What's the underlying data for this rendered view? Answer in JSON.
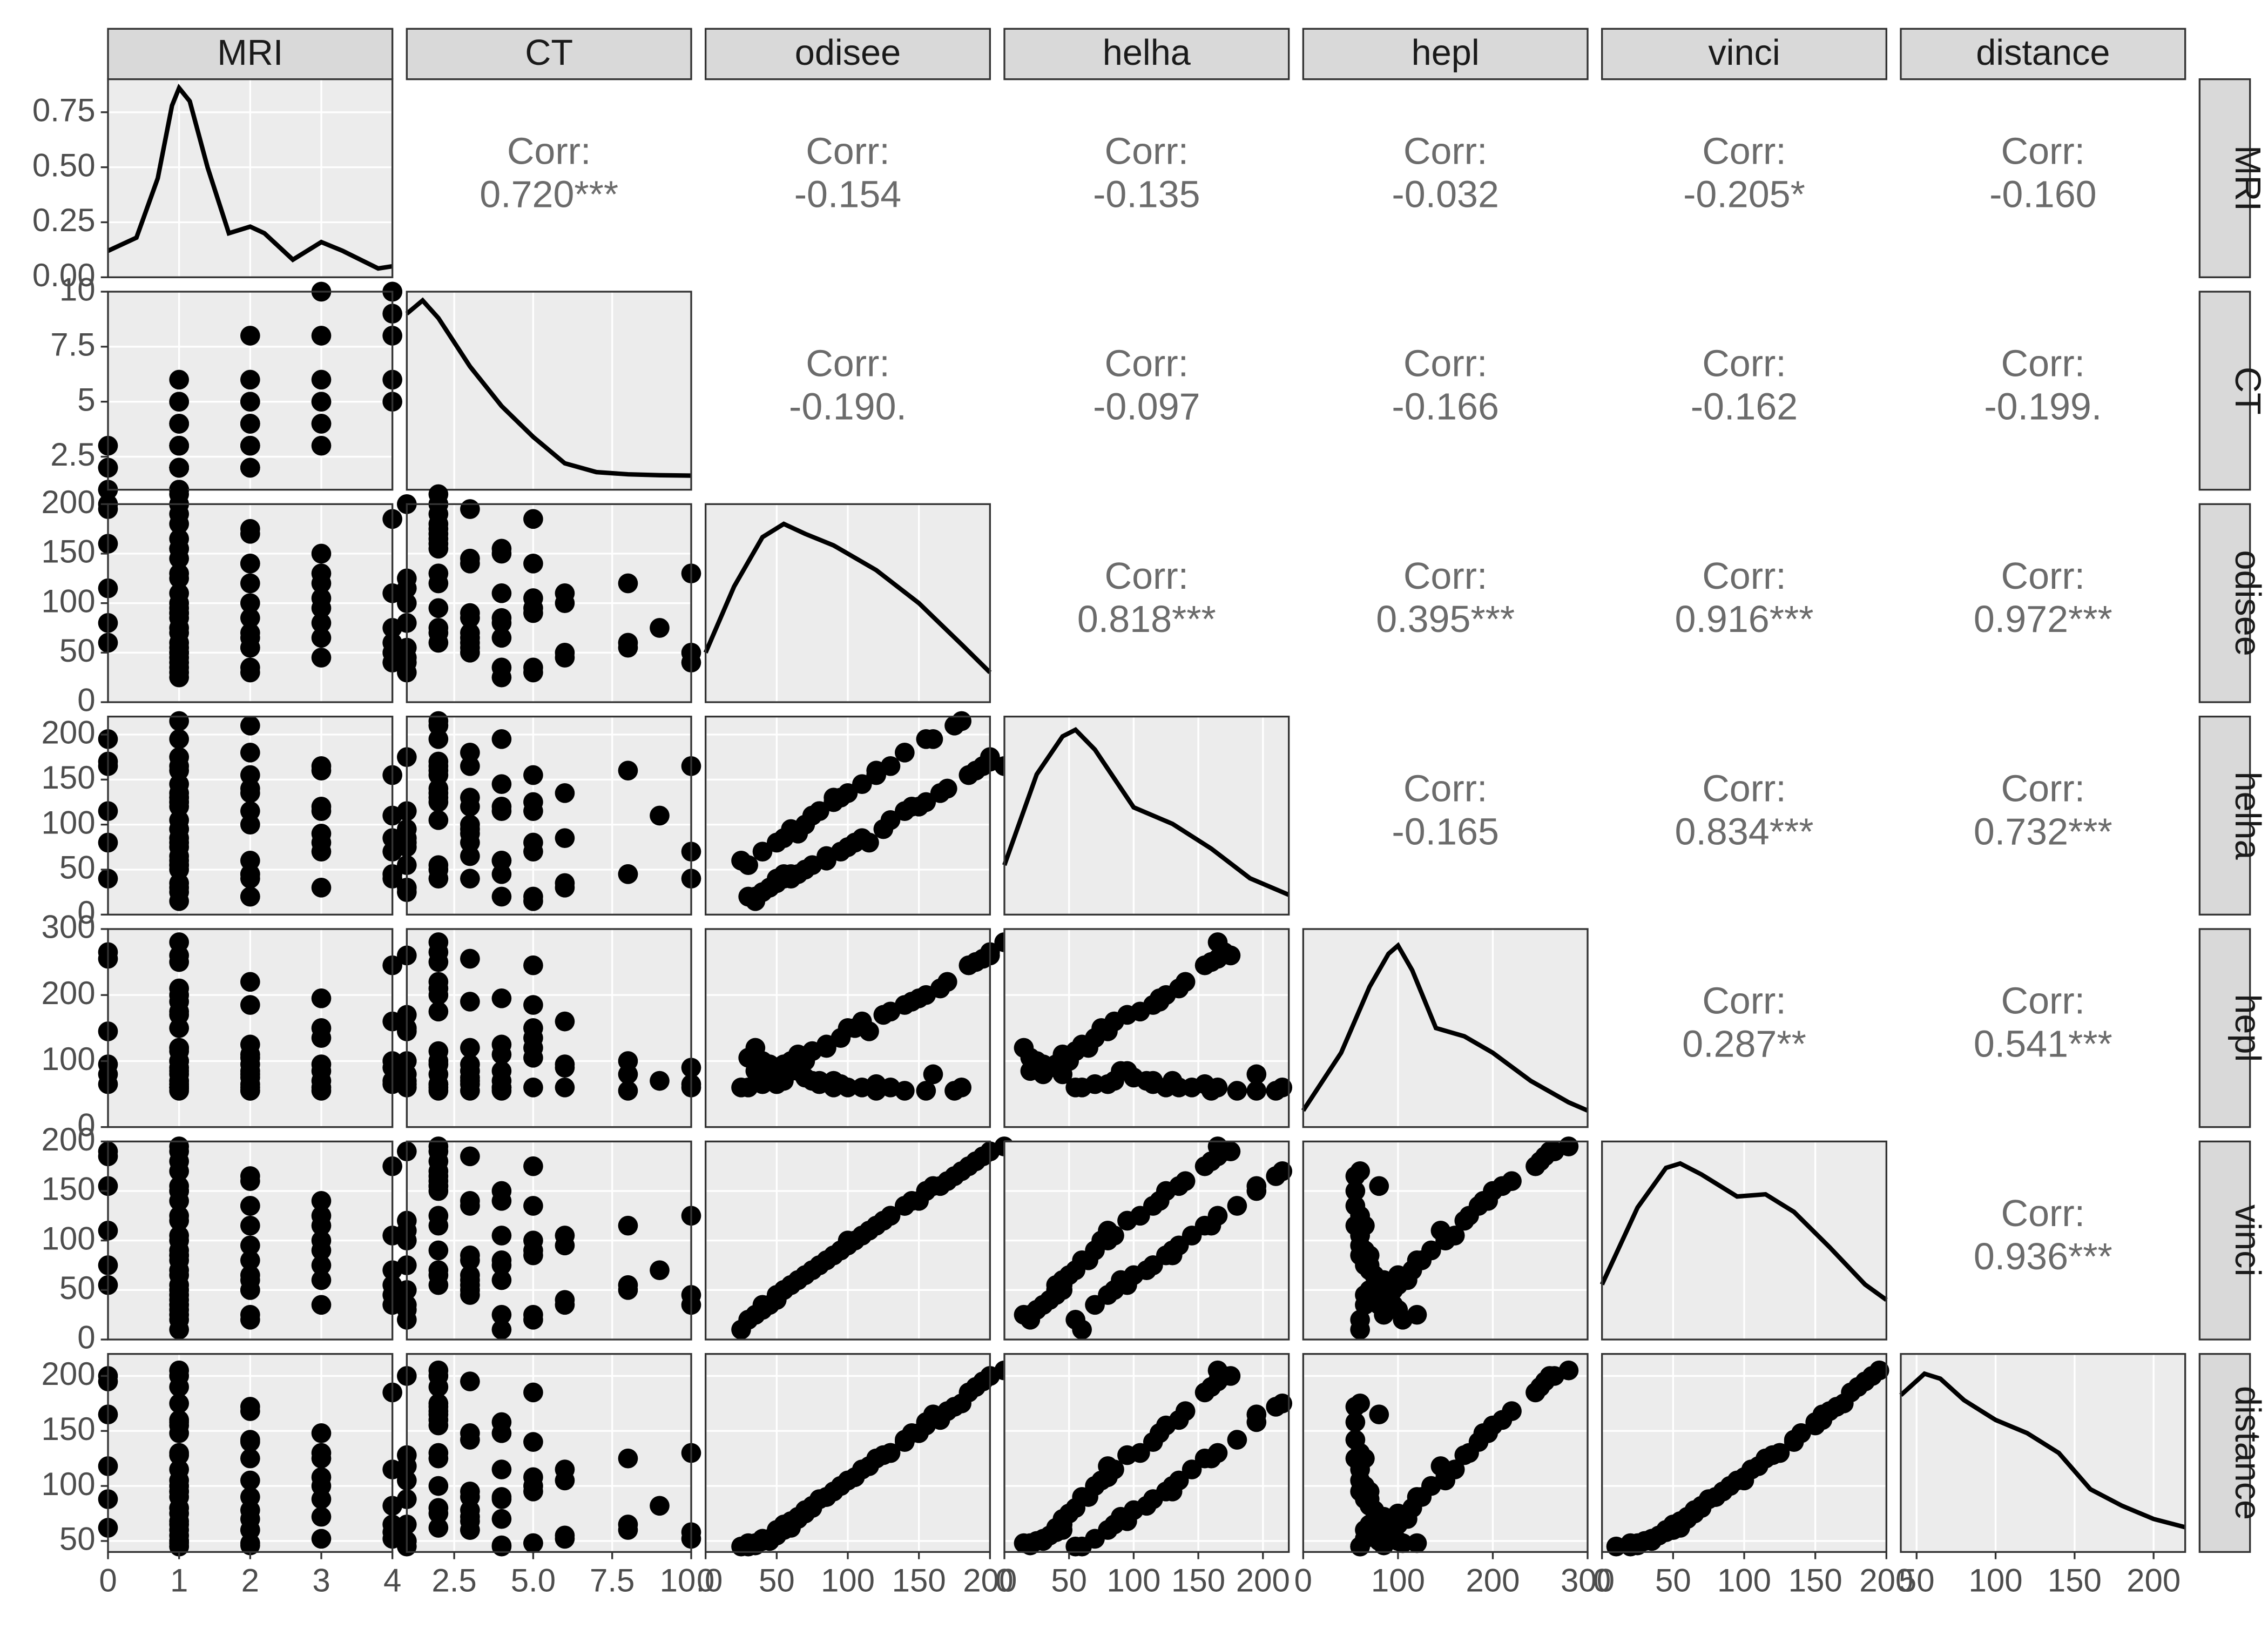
{
  "chart_data": {
    "type": "pairs",
    "variables": [
      "MRI",
      "CT",
      "odisee",
      "helha",
      "hepl",
      "vinci",
      "distance"
    ],
    "axis_ranges": {
      "MRI": [
        0,
        4
      ],
      "CT": [
        1,
        10
      ],
      "odisee": [
        0,
        200
      ],
      "helha": [
        0,
        220
      ],
      "hepl": [
        0,
        300
      ],
      "vinci": [
        0,
        200
      ],
      "distance": [
        40,
        220
      ]
    },
    "x_ticks": {
      "MRI": [
        0,
        1,
        2,
        3,
        4
      ],
      "CT": [
        2.5,
        5.0,
        7.5,
        10.0
      ],
      "odisee": [
        0,
        50,
        100,
        150,
        200
      ],
      "helha": [
        0,
        50,
        100,
        150,
        200
      ],
      "hepl": [
        0,
        100,
        200,
        300
      ],
      "vinci": [
        0,
        50,
        100,
        150,
        200
      ],
      "distance": [
        50,
        100,
        150,
        200
      ]
    },
    "y_ticks": {
      "MRI": [
        0.0,
        0.25,
        0.5,
        0.75
      ],
      "CT": [
        2.5,
        5.0,
        7.5,
        10.0
      ],
      "odisee": [
        0,
        50,
        100,
        150,
        200
      ],
      "helha": [
        0,
        50,
        100,
        150,
        200
      ],
      "hepl": [
        0,
        100,
        200,
        300
      ],
      "vinci": [
        0,
        50,
        100,
        150,
        200
      ],
      "distance": [
        50,
        100,
        150,
        200
      ]
    },
    "y_range_diag": {
      "MRI": [
        0,
        0.9
      ],
      "CT": [
        0,
        0.45
      ],
      "odisee": [
        0,
        0.012
      ],
      "helha": [
        0,
        0.012
      ],
      "hepl": [
        0,
        0.012
      ],
      "vinci": [
        0,
        0.009
      ],
      "distance": [
        0,
        0.012
      ]
    },
    "correlations": {
      "MRI": {
        "CT": "0.720***",
        "odisee": "-0.154",
        "helha": "-0.135",
        "hepl": "-0.032",
        "vinci": "-0.205*",
        "distance": "-0.160"
      },
      "CT": {
        "odisee": "-0.190.",
        "helha": "-0.097",
        "hepl": "-0.166",
        "vinci": "-0.162",
        "distance": "-0.199."
      },
      "odisee": {
        "helha": "0.818***",
        "hepl": "0.395***",
        "vinci": "0.916***",
        "distance": "0.972***"
      },
      "helha": {
        "hepl": "-0.165",
        "vinci": "0.834***",
        "distance": "0.732***"
      },
      "hepl": {
        "vinci": "0.287**",
        "distance": "0.541***"
      },
      "vinci": {
        "distance": "0.936***"
      }
    },
    "density": {
      "MRI": [
        [
          0,
          0.12
        ],
        [
          0.4,
          0.18
        ],
        [
          0.7,
          0.45
        ],
        [
          0.9,
          0.78
        ],
        [
          1.0,
          0.86
        ],
        [
          1.15,
          0.8
        ],
        [
          1.4,
          0.5
        ],
        [
          1.7,
          0.2
        ],
        [
          2.0,
          0.23
        ],
        [
          2.2,
          0.2
        ],
        [
          2.6,
          0.08
        ],
        [
          3.0,
          0.16
        ],
        [
          3.3,
          0.12
        ],
        [
          3.8,
          0.04
        ],
        [
          4,
          0.05
        ]
      ],
      "CT": [
        [
          1,
          0.4
        ],
        [
          1.5,
          0.43
        ],
        [
          2,
          0.39
        ],
        [
          3,
          0.28
        ],
        [
          4,
          0.19
        ],
        [
          5,
          0.12
        ],
        [
          6,
          0.06
        ],
        [
          7,
          0.04
        ],
        [
          8,
          0.035
        ],
        [
          9,
          0.033
        ],
        [
          10,
          0.032
        ]
      ],
      "odisee": [
        [
          0,
          0.003
        ],
        [
          20,
          0.007
        ],
        [
          40,
          0.01
        ],
        [
          55,
          0.0108
        ],
        [
          70,
          0.0102
        ],
        [
          90,
          0.0095
        ],
        [
          120,
          0.008
        ],
        [
          150,
          0.006
        ],
        [
          180,
          0.0035
        ],
        [
          200,
          0.0018
        ]
      ],
      "helha": [
        [
          0,
          0.003
        ],
        [
          25,
          0.0085
        ],
        [
          45,
          0.0108
        ],
        [
          55,
          0.0112
        ],
        [
          70,
          0.01
        ],
        [
          100,
          0.0065
        ],
        [
          130,
          0.0055
        ],
        [
          160,
          0.004
        ],
        [
          190,
          0.0022
        ],
        [
          220,
          0.0012
        ]
      ],
      "hepl": [
        [
          0,
          0.001
        ],
        [
          40,
          0.0045
        ],
        [
          70,
          0.0085
        ],
        [
          90,
          0.0105
        ],
        [
          100,
          0.011
        ],
        [
          115,
          0.0095
        ],
        [
          140,
          0.006
        ],
        [
          170,
          0.0055
        ],
        [
          200,
          0.0045
        ],
        [
          240,
          0.0028
        ],
        [
          280,
          0.0015
        ],
        [
          300,
          0.001
        ]
      ],
      "vinci": [
        [
          0,
          0.0025
        ],
        [
          25,
          0.006
        ],
        [
          45,
          0.0078
        ],
        [
          55,
          0.008
        ],
        [
          70,
          0.0075
        ],
        [
          95,
          0.0065
        ],
        [
          115,
          0.0066
        ],
        [
          135,
          0.0058
        ],
        [
          160,
          0.0042
        ],
        [
          185,
          0.0025
        ],
        [
          200,
          0.0018
        ]
      ],
      "distance": [
        [
          40,
          0.0095
        ],
        [
          55,
          0.0108
        ],
        [
          65,
          0.0105
        ],
        [
          80,
          0.0092
        ],
        [
          100,
          0.008
        ],
        [
          120,
          0.0072
        ],
        [
          140,
          0.006
        ],
        [
          160,
          0.0038
        ],
        [
          180,
          0.0028
        ],
        [
          200,
          0.002
        ],
        [
          220,
          0.0015
        ]
      ]
    },
    "observations": [
      {
        "MRI": 0,
        "CT": 2,
        "odisee": 160,
        "helha": 195,
        "hepl": 80,
        "vinci": 155,
        "distance": 165
      },
      {
        "MRI": 0,
        "CT": 2,
        "odisee": 60,
        "helha": 40,
        "hepl": 95,
        "vinci": 55,
        "distance": 62
      },
      {
        "MRI": 0,
        "CT": 1,
        "odisee": 115,
        "helha": 80,
        "hepl": 145,
        "vinci": 110,
        "distance": 118
      },
      {
        "MRI": 1,
        "CT": 2,
        "odisee": 210,
        "helha": 165,
        "hepl": 280,
        "vinci": 195,
        "distance": 205
      },
      {
        "MRI": 1,
        "CT": 1,
        "odisee": 40,
        "helha": 25,
        "hepl": 100,
        "vinci": 30,
        "distance": 50
      },
      {
        "MRI": 1,
        "CT": 3,
        "odisee": 90,
        "helha": 130,
        "hepl": 70,
        "vinci": 85,
        "distance": 95
      },
      {
        "MRI": 1,
        "CT": 4,
        "odisee": 25,
        "helha": 60,
        "hepl": 60,
        "vinci": 10,
        "distance": 45
      },
      {
        "MRI": 1,
        "CT": 2,
        "odisee": 75,
        "helha": 55,
        "hepl": 115,
        "vinci": 70,
        "distance": 80
      },
      {
        "MRI": 1,
        "CT": 3,
        "odisee": 60,
        "helha": 95,
        "hepl": 85,
        "vinci": 55,
        "distance": 68
      },
      {
        "MRI": 1,
        "CT": 5,
        "odisee": 35,
        "helha": 15,
        "hepl": 120,
        "vinci": 25,
        "distance": 48
      },
      {
        "MRI": 1,
        "CT": 2,
        "odisee": 180,
        "helha": 215,
        "hepl": 60,
        "vinci": 170,
        "distance": 175
      },
      {
        "MRI": 1,
        "CT": 1,
        "odisee": 100,
        "helha": 75,
        "hepl": 150,
        "vinci": 100,
        "distance": 105
      },
      {
        "MRI": 1,
        "CT": 6,
        "odisee": 50,
        "helha": 35,
        "hepl": 90,
        "vinci": 40,
        "distance": 55
      },
      {
        "MRI": 1,
        "CT": 2,
        "odisee": 130,
        "helha": 105,
        "hepl": 175,
        "vinci": 125,
        "distance": 130
      },
      {
        "MRI": 1,
        "CT": 1,
        "odisee": 200,
        "helha": 175,
        "hepl": 260,
        "vinci": 190,
        "distance": 200
      },
      {
        "MRI": 2,
        "CT": 3,
        "odisee": 140,
        "helha": 180,
        "hepl": 55,
        "vinci": 135,
        "distance": 142
      },
      {
        "MRI": 2,
        "CT": 5,
        "odisee": 30,
        "helha": 20,
        "hepl": 105,
        "vinci": 20,
        "distance": 48
      },
      {
        "MRI": 2,
        "CT": 4,
        "odisee": 85,
        "helha": 60,
        "hepl": 125,
        "vinci": 80,
        "distance": 90
      },
      {
        "MRI": 2,
        "CT": 2,
        "odisee": 170,
        "helha": 140,
        "hepl": 220,
        "vinci": 160,
        "distance": 168
      },
      {
        "MRI": 2,
        "CT": 8,
        "odisee": 55,
        "helha": 45,
        "hepl": 80,
        "vinci": 50,
        "distance": 60
      },
      {
        "MRI": 2,
        "CT": 2,
        "odisee": 120,
        "helha": 155,
        "hepl": 65,
        "vinci": 115,
        "distance": 125
      },
      {
        "MRI": 2,
        "CT": 3,
        "odisee": 70,
        "helha": 100,
        "hepl": 75,
        "vinci": 65,
        "distance": 78
      },
      {
        "MRI": 3,
        "CT": 5,
        "odisee": 95,
        "helha": 70,
        "hepl": 135,
        "vinci": 90,
        "distance": 100
      },
      {
        "MRI": 3,
        "CT": 4,
        "odisee": 150,
        "helha": 120,
        "hepl": 195,
        "vinci": 140,
        "distance": 148
      },
      {
        "MRI": 3,
        "CT": 6,
        "odisee": 45,
        "helha": 30,
        "hepl": 95,
        "vinci": 35,
        "distance": 52
      },
      {
        "MRI": 3,
        "CT": 3,
        "odisee": 65,
        "helha": 90,
        "hepl": 85,
        "vinci": 60,
        "distance": 72
      },
      {
        "MRI": 3,
        "CT": 10,
        "odisee": 130,
        "helha": 165,
        "hepl": 60,
        "vinci": 125,
        "distance": 130
      },
      {
        "MRI": 3,
        "CT": 5,
        "odisee": 105,
        "helha": 80,
        "hepl": 150,
        "vinci": 100,
        "distance": 108
      },
      {
        "MRI": 4,
        "CT": 10,
        "odisee": 50,
        "helha": 40,
        "hepl": 90,
        "vinci": 45,
        "distance": 58
      },
      {
        "MRI": 4,
        "CT": 5,
        "odisee": 185,
        "helha": 155,
        "hepl": 245,
        "vinci": 175,
        "distance": 185
      },
      {
        "MRI": 4,
        "CT": 9,
        "odisee": 75,
        "helha": 110,
        "hepl": 70,
        "vinci": 70,
        "distance": 82
      },
      {
        "MRI": 4,
        "CT": 6,
        "odisee": 110,
        "helha": 85,
        "hepl": 160,
        "vinci": 105,
        "distance": 115
      },
      {
        "MRI": 4,
        "CT": 10,
        "odisee": 40,
        "helha": 70,
        "hepl": 65,
        "vinci": 35,
        "distance": 52
      },
      {
        "MRI": 0,
        "CT": 3,
        "odisee": 195,
        "helha": 165,
        "hepl": 255,
        "vinci": 185,
        "distance": 195
      },
      {
        "MRI": 0,
        "CT": 1,
        "odisee": 80,
        "helha": 115,
        "hepl": 65,
        "vinci": 75,
        "distance": 88
      },
      {
        "MRI": 1,
        "CT": 4,
        "odisee": 155,
        "helha": 195,
        "hepl": 55,
        "vinci": 150,
        "distance": 158
      },
      {
        "MRI": 1,
        "CT": 1,
        "odisee": 45,
        "helha": 30,
        "hepl": 80,
        "vinci": 35,
        "distance": 50
      },
      {
        "MRI": 1,
        "CT": 2,
        "odisee": 165,
        "helha": 135,
        "hepl": 210,
        "vinci": 155,
        "distance": 160
      },
      {
        "MRI": 2,
        "CT": 6,
        "odisee": 100,
        "helha": 135,
        "hepl": 60,
        "vinci": 95,
        "distance": 105
      },
      {
        "MRI": 2,
        "CT": 3,
        "odisee": 55,
        "helha": 40,
        "hepl": 95,
        "vinci": 50,
        "distance": 60
      },
      {
        "MRI": 1,
        "CT": 1,
        "odisee": 125,
        "helha": 95,
        "hepl": 170,
        "vinci": 120,
        "distance": 128
      },
      {
        "MRI": 1,
        "CT": 2,
        "odisee": 70,
        "helha": 50,
        "hepl": 100,
        "vinci": 65,
        "distance": 75
      },
      {
        "MRI": 3,
        "CT": 4,
        "odisee": 80,
        "helha": 115,
        "hepl": 70,
        "vinci": 75,
        "distance": 88
      },
      {
        "MRI": 1,
        "CT": 2,
        "odisee": 190,
        "helha": 160,
        "hepl": 250,
        "vinci": 180,
        "distance": 190
      },
      {
        "MRI": 1,
        "CT": 3,
        "odisee": 50,
        "helha": 80,
        "hepl": 65,
        "vinci": 45,
        "distance": 60
      },
      {
        "MRI": 2,
        "CT": 5,
        "odisee": 140,
        "helha": 115,
        "hepl": 185,
        "vinci": 135,
        "distance": 140
      },
      {
        "MRI": 1,
        "CT": 1,
        "odisee": 30,
        "helha": 55,
        "hepl": 60,
        "vinci": 20,
        "distance": 45
      },
      {
        "MRI": 2,
        "CT": 2,
        "odisee": 175,
        "helha": 210,
        "hepl": 55,
        "vinci": 165,
        "distance": 172
      },
      {
        "MRI": 1,
        "CT": 4,
        "odisee": 110,
        "helha": 145,
        "hepl": 60,
        "vinci": 105,
        "distance": 115
      },
      {
        "MRI": 3,
        "CT": 8,
        "odisee": 120,
        "helha": 160,
        "hepl": 55,
        "vinci": 115,
        "distance": 125
      },
      {
        "MRI": 1,
        "CT": 2,
        "odisee": 95,
        "helha": 130,
        "hepl": 65,
        "vinci": 90,
        "distance": 100
      },
      {
        "MRI": 2,
        "CT": 4,
        "odisee": 65,
        "helha": 45,
        "hepl": 110,
        "vinci": 60,
        "distance": 70
      },
      {
        "MRI": 1,
        "CT": 3,
        "odisee": 85,
        "helha": 65,
        "hepl": 120,
        "vinci": 80,
        "distance": 90
      },
      {
        "MRI": 0,
        "CT": 2,
        "odisee": 200,
        "helha": 170,
        "hepl": 265,
        "vinci": 190,
        "distance": 200
      },
      {
        "MRI": 1,
        "CT": 1,
        "odisee": 55,
        "helha": 85,
        "hepl": 70,
        "vinci": 50,
        "distance": 65
      },
      {
        "MRI": 1,
        "CT": 3,
        "odisee": 145,
        "helha": 120,
        "hepl": 190,
        "vinci": 140,
        "distance": 148
      },
      {
        "MRI": 2,
        "CT": 4,
        "odisee": 35,
        "helha": 20,
        "hepl": 85,
        "vinci": 25,
        "distance": 46
      },
      {
        "MRI": 1,
        "CT": 5,
        "odisee": 90,
        "helha": 125,
        "hepl": 60,
        "vinci": 85,
        "distance": 95
      },
      {
        "MRI": 4,
        "CT": 8,
        "odisee": 60,
        "helha": 45,
        "hepl": 100,
        "vinci": 55,
        "distance": 65
      },
      {
        "MRI": 1,
        "CT": 2,
        "odisee": 155,
        "helha": 125,
        "hepl": 200,
        "vinci": 150,
        "distance": 155
      }
    ]
  },
  "labels": {
    "corr": "Corr:"
  }
}
